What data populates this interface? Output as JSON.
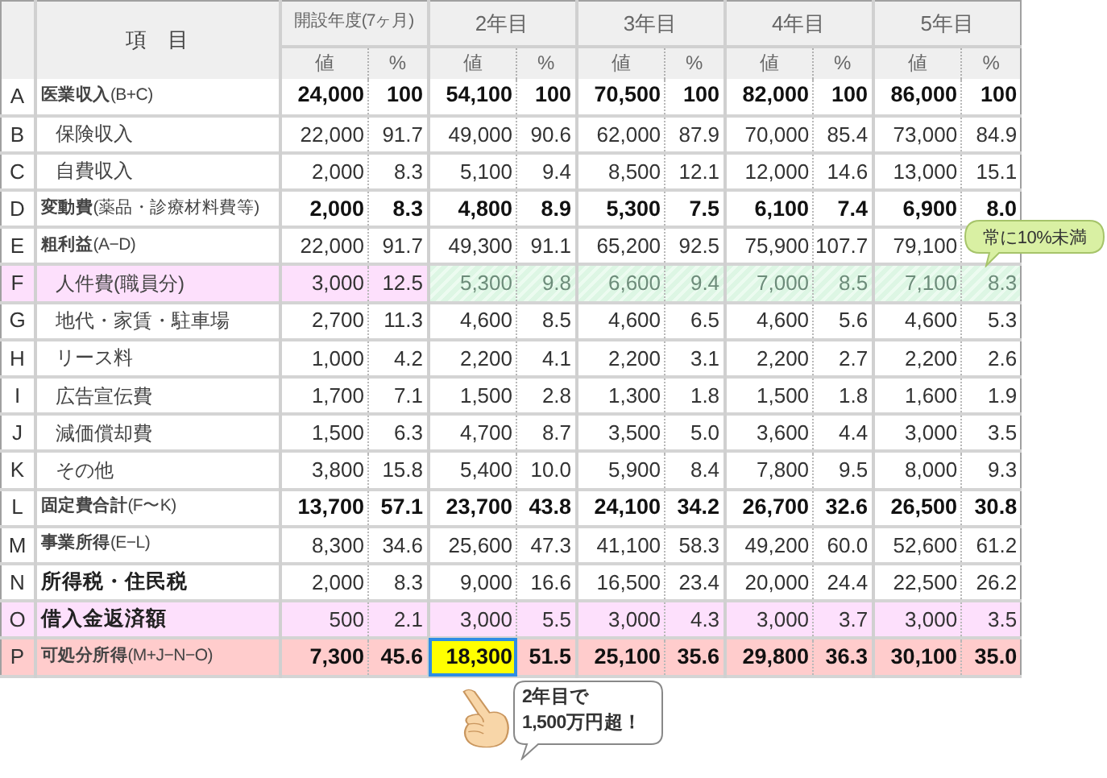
{
  "table": {
    "item_header": "項　目",
    "years": [
      {
        "label": "開設年度(7ヶ月)",
        "value_header": "値",
        "pct_header": "%"
      },
      {
        "label": "2年目",
        "value_header": "値",
        "pct_header": "%"
      },
      {
        "label": "3年目",
        "value_header": "値",
        "pct_header": "%"
      },
      {
        "label": "4年目",
        "value_header": "値",
        "pct_header": "%"
      },
      {
        "label": "5年目",
        "value_header": "値",
        "pct_header": "%"
      }
    ],
    "rows": [
      {
        "letter": "A",
        "kind": "total",
        "label": "**医業収入**(B+C)",
        "cells": [
          {
            "value": "24,000",
            "pct": "100"
          },
          {
            "value": "54,100",
            "pct": "100"
          },
          {
            "value": "70,500",
            "pct": "100"
          },
          {
            "value": "82,000",
            "pct": "100"
          },
          {
            "value": "86,000",
            "pct": "100"
          }
        ]
      },
      {
        "letter": "B",
        "kind": "item",
        "label": "保険収入",
        "cells": [
          {
            "value": "22,000",
            "pct": "91.7"
          },
          {
            "value": "49,000",
            "pct": "90.6"
          },
          {
            "value": "62,000",
            "pct": "87.9"
          },
          {
            "value": "70,000",
            "pct": "85.4"
          },
          {
            "value": "73,000",
            "pct": "84.9"
          }
        ]
      },
      {
        "letter": "C",
        "kind": "item",
        "label": "自費収入",
        "cells": [
          {
            "value": "2,000",
            "pct": "8.3"
          },
          {
            "value": "5,100",
            "pct": "9.4"
          },
          {
            "value": "8,500",
            "pct": "12.1"
          },
          {
            "value": "12,000",
            "pct": "14.6"
          },
          {
            "value": "13,000",
            "pct": "15.1"
          }
        ]
      },
      {
        "letter": "D",
        "kind": "total",
        "label": "**変動費**(薬品・診療材料費等)",
        "cells": [
          {
            "value": "2,000",
            "pct": "8.3"
          },
          {
            "value": "4,800",
            "pct": "8.9"
          },
          {
            "value": "5,300",
            "pct": "7.5"
          },
          {
            "value": "6,100",
            "pct": "7.4"
          },
          {
            "value": "6,900",
            "pct": "8.0"
          }
        ]
      },
      {
        "letter": "E",
        "kind": "subtotal",
        "label": "**粗利益**(A−D)",
        "cells": [
          {
            "value": "22,000",
            "pct": "91.7"
          },
          {
            "value": "49,300",
            "pct": "91.1"
          },
          {
            "value": "65,200",
            "pct": "92.5"
          },
          {
            "value": "75,900",
            "pct": "107.7"
          },
          {
            "value": "79,100"
          }
        ]
      },
      {
        "letter": "F",
        "kind": "item",
        "label": "人件費(職員分)",
        "color": "#fde0fc",
        "cells": [
          {
            "value": "3,000",
            "pct": "12.5",
            "hatched": false
          },
          {
            "value": "5,300",
            "pct": "9.8",
            "hatched": true
          },
          {
            "value": "6,600",
            "pct": "9.4",
            "hatched": true
          },
          {
            "value": "7,000",
            "pct": "8.5",
            "hatched": true
          },
          {
            "value": "7,100",
            "pct": "8.3",
            "hatched": true
          }
        ]
      },
      {
        "letter": "G",
        "kind": "item",
        "label": "地代・家賃・駐車場",
        "cells": [
          {
            "value": "2,700",
            "pct": "11.3"
          },
          {
            "value": "4,600",
            "pct": "8.5"
          },
          {
            "value": "4,600",
            "pct": "6.5"
          },
          {
            "value": "4,600",
            "pct": "5.6"
          },
          {
            "value": "4,600",
            "pct": "5.3"
          }
        ]
      },
      {
        "letter": "H",
        "kind": "item",
        "label": "リース料",
        "cells": [
          {
            "value": "1,000",
            "pct": "4.2"
          },
          {
            "value": "2,200",
            "pct": "4.1"
          },
          {
            "value": "2,200",
            "pct": "3.1"
          },
          {
            "value": "2,200",
            "pct": "2.7"
          },
          {
            "value": "2,200",
            "pct": "2.6"
          }
        ]
      },
      {
        "letter": "I",
        "kind": "item",
        "label": "広告宣伝費",
        "cells": [
          {
            "value": "1,700",
            "pct": "7.1"
          },
          {
            "value": "1,500",
            "pct": "2.8"
          },
          {
            "value": "1,300",
            "pct": "1.8"
          },
          {
            "value": "1,500",
            "pct": "1.8"
          },
          {
            "value": "1,600",
            "pct": "1.9"
          }
        ]
      },
      {
        "letter": "J",
        "kind": "item",
        "label": "減価償却費",
        "cells": [
          {
            "value": "1,500",
            "pct": "6.3"
          },
          {
            "value": "4,700",
            "pct": "8.7"
          },
          {
            "value": "3,500",
            "pct": "5.0"
          },
          {
            "value": "3,600",
            "pct": "4.4"
          },
          {
            "value": "3,000",
            "pct": "3.5"
          }
        ]
      },
      {
        "letter": "K",
        "kind": "item",
        "label": "その他",
        "cells": [
          {
            "value": "3,800",
            "pct": "15.8"
          },
          {
            "value": "5,400",
            "pct": "10.0"
          },
          {
            "value": "5,900",
            "pct": "8.4"
          },
          {
            "value": "7,800",
            "pct": "9.5"
          },
          {
            "value": "8,000",
            "pct": "9.3"
          }
        ]
      },
      {
        "letter": "L",
        "kind": "total",
        "label": "**固定費合計**(F〜K)",
        "cells": [
          {
            "value": "13,700",
            "pct": "57.1"
          },
          {
            "value": "23,700",
            "pct": "43.8"
          },
          {
            "value": "24,100",
            "pct": "34.2"
          },
          {
            "value": "26,700",
            "pct": "32.6"
          },
          {
            "value": "26,500",
            "pct": "30.8"
          }
        ]
      },
      {
        "letter": "M",
        "kind": "subtotal",
        "label": "**事業所得**(E−L)",
        "cells": [
          {
            "value": "8,300",
            "pct": "34.6"
          },
          {
            "value": "25,600",
            "pct": "47.3"
          },
          {
            "value": "41,100",
            "pct": "58.3"
          },
          {
            "value": "49,200",
            "pct": "60.0"
          },
          {
            "value": "52,600",
            "pct": "61.2"
          }
        ]
      },
      {
        "letter": "N",
        "kind": "group",
        "label": "所得税・住民税",
        "cells": [
          {
            "value": "2,000",
            "pct": "8.3"
          },
          {
            "value": "9,000",
            "pct": "16.6"
          },
          {
            "value": "16,500",
            "pct": "23.4"
          },
          {
            "value": "20,000",
            "pct": "24.4"
          },
          {
            "value": "22,500",
            "pct": "26.2"
          }
        ]
      },
      {
        "letter": "O",
        "kind": "group",
        "label": "借入金返済額",
        "color": "#fde0fc",
        "cells": [
          {
            "value": "500",
            "pct": "2.1"
          },
          {
            "value": "3,000",
            "pct": "5.5"
          },
          {
            "value": "3,000",
            "pct": "4.3"
          },
          {
            "value": "3,000",
            "pct": "3.7"
          },
          {
            "value": "3,000",
            "pct": "3.5"
          }
        ]
      },
      {
        "letter": "P",
        "kind": "total",
        "label": "**可処分所得**(M+J−N−O)",
        "color": "#ffcccc",
        "cells": [
          {
            "value": "7,300",
            "pct": "45.6",
            "highlighted": false
          },
          {
            "value": "18,300",
            "pct": "51.5",
            "highlighted": true
          },
          {
            "value": "25,100",
            "pct": "35.6",
            "highlighted": false
          },
          {
            "value": "29,800",
            "pct": "36.3",
            "highlighted": false
          },
          {
            "value": "30,100",
            "pct": "35.0",
            "highlighted": false
          }
        ]
      }
    ]
  },
  "notes": [
    {
      "kind": "callout",
      "lines": [
        "常に10%未満"
      ]
    },
    {
      "kind": "speech",
      "lines": [
        "2年目で",
        "1,500万円超！"
      ]
    }
  ]
}
